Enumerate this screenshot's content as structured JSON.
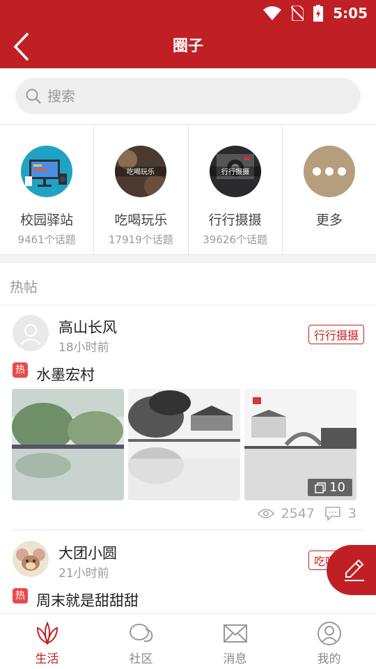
{
  "status_bar": {
    "time": "5:05"
  },
  "header": {
    "title": "圈子"
  },
  "search": {
    "placeholder": "搜索"
  },
  "categories": [
    {
      "name": "校园驿站",
      "count": "9461个话题",
      "overlay": ""
    },
    {
      "name": "吃喝玩乐",
      "count": "17919个话题",
      "overlay": "吃喝玩乐"
    },
    {
      "name": "行行摄摄",
      "count": "39626个话题",
      "overlay": "行行摄摄"
    },
    {
      "name": "更多",
      "count": "",
      "overlay": ""
    }
  ],
  "section_title": "热帖",
  "posts": [
    {
      "author": "高山长风",
      "time": "18小时前",
      "tag": "行行摄摄",
      "hot_label": "热",
      "title": "水墨宏村",
      "image_count": "10",
      "views": "2547",
      "comments": "3"
    },
    {
      "author": "大团小圆",
      "time": "21小时前",
      "tag": "吃喝玩乐",
      "hot_label": "热",
      "title": "周末就是甜甜甜"
    }
  ],
  "tabs": [
    {
      "label": "生活",
      "active": true
    },
    {
      "label": "社区",
      "active": false
    },
    {
      "label": "消息",
      "active": false
    },
    {
      "label": "我的",
      "active": false
    }
  ],
  "colors": {
    "brand": "#c02025",
    "hot_badge": "#e94a4a"
  }
}
